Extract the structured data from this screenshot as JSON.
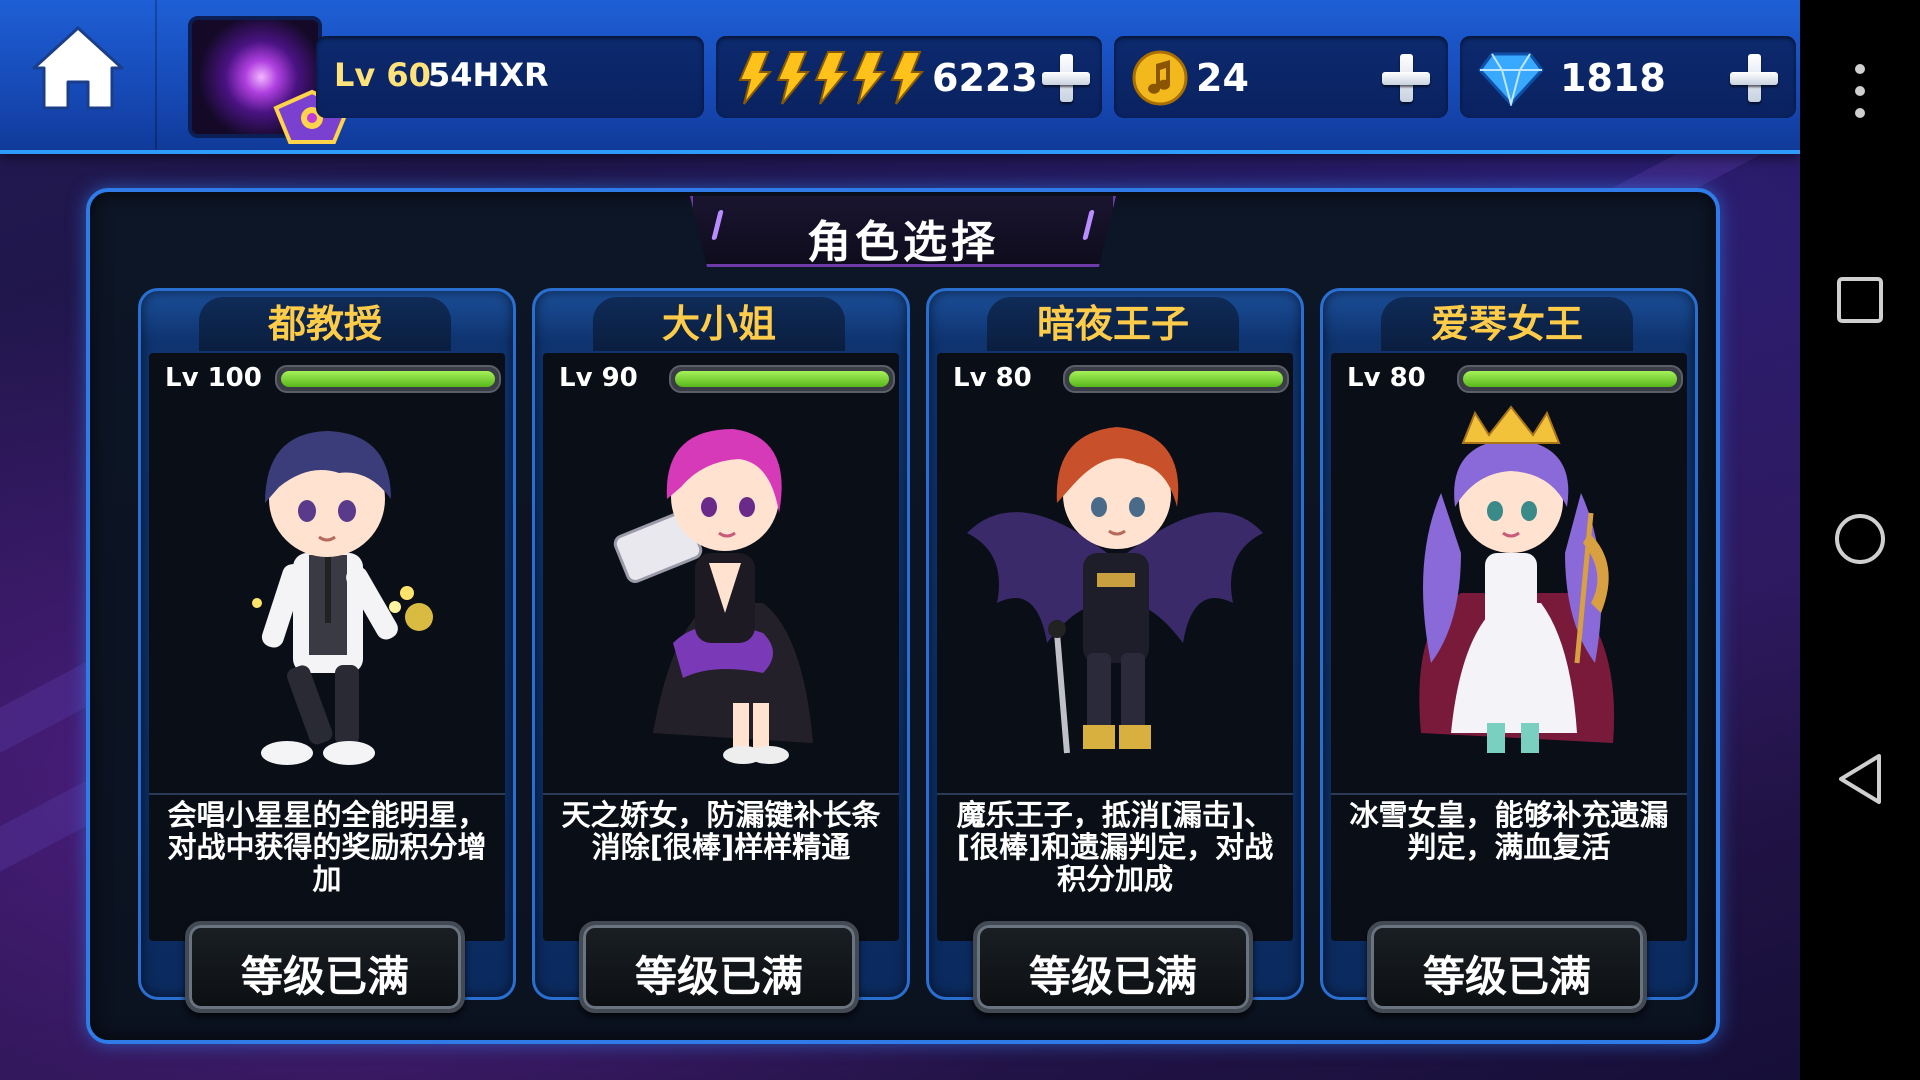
{
  "player": {
    "level": "Lv 60",
    "name": "54HXR"
  },
  "resources": {
    "energy": {
      "value": "6223",
      "icon": "lightning-bolt-icon"
    },
    "coins": {
      "value": "24",
      "icon": "music-note-coin-icon"
    },
    "gems": {
      "value": "1818",
      "icon": "blue-diamond-icon"
    }
  },
  "panel": {
    "title": "角色选择"
  },
  "characters": [
    {
      "name": "都教授",
      "level": "Lv 100",
      "progress": 1.0,
      "description": "会唱小星星的全能明星，对战中获得的奖励积分增加",
      "button": "等级已满"
    },
    {
      "name": "大小姐",
      "level": "Lv 90",
      "progress": 1.0,
      "description": "天之娇女，防漏键补长条消除[很棒]样样精通",
      "button": "等级已满"
    },
    {
      "name": "暗夜王子",
      "level": "Lv 80",
      "progress": 1.0,
      "description": "魔乐王子，抵消[漏击]、[很棒]和遗漏判定，对战积分加成",
      "button": "等级已满"
    },
    {
      "name": "爱琴女王",
      "level": "Lv 80",
      "progress": 1.0,
      "description": "冰雪女皇，能够补充遗漏判定，满血复活",
      "button": "等级已满"
    }
  ],
  "colors": {
    "accent": "#2f7be8",
    "name_gold": "#ffcc4a",
    "bar_green": "#7ad63a",
    "topbar": "#1546b0"
  }
}
